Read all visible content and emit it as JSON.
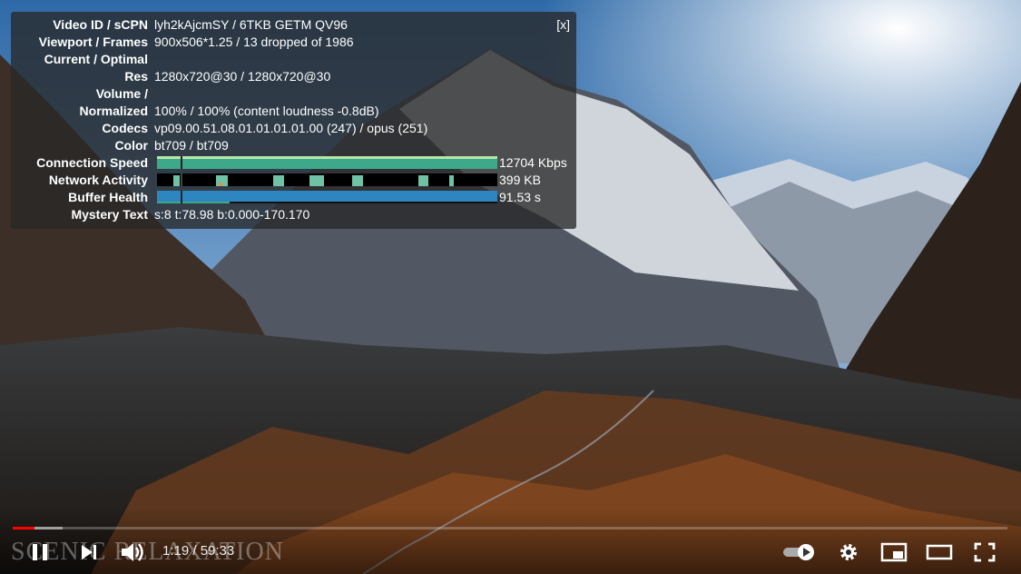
{
  "stats": {
    "close_label": "[x]",
    "rows": [
      {
        "label": "Video ID / sCPN",
        "value": "lyh2kAjcmSY / 6TKB GETM QV96"
      },
      {
        "label": "Viewport / Frames",
        "value": "900x506*1.25 / 13 dropped of 1986"
      },
      {
        "label": "Current / Optimal",
        "value": ""
      },
      {
        "label": "Res",
        "value": "1280x720@30 / 1280x720@30"
      },
      {
        "label": "Volume /",
        "value": ""
      },
      {
        "label": "Normalized",
        "value": "100% / 100% (content loudness -0.8dB)"
      },
      {
        "label": "Codecs",
        "value": "vp09.00.51.08.01.01.01.01.00 (247) / opus (251)"
      },
      {
        "label": "Color",
        "value": "bt709 / bt709"
      },
      {
        "label": "Connection Speed",
        "value": "12704 Kbps"
      },
      {
        "label": "Network Activity",
        "value": "399 KB"
      },
      {
        "label": "Buffer Health",
        "value": "91.53 s"
      },
      {
        "label": "Mystery Text",
        "value": "s:8 t:78.98 b:0.000-170.170"
      }
    ]
  },
  "player": {
    "time": "1:19 / 59:33",
    "progress_played": 0.022,
    "progress_loaded": 0.05,
    "watermark": "SCENIC RELAXATION"
  },
  "colors": {
    "played": "#ff0000",
    "speed_bar": "#3ea88a",
    "buffer_bar": "#2e86c1"
  },
  "icons": [
    "pause-icon",
    "next-icon",
    "volume-icon",
    "autoplay-toggle-icon",
    "settings-icon",
    "miniplayer-icon",
    "theater-icon",
    "fullscreen-icon"
  ]
}
